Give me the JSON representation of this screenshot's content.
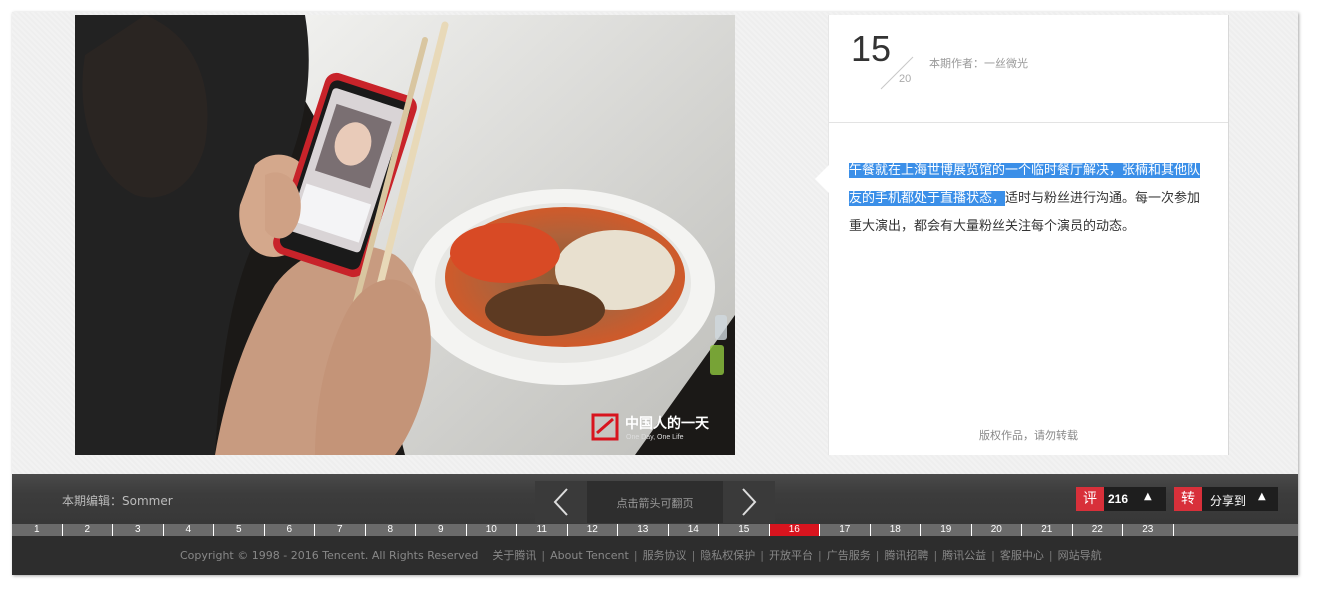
{
  "card": {
    "page_current": "15",
    "page_total": "20",
    "author_label": "本期作者：",
    "author_name": "一丝微光",
    "caption_selected": "午餐就在上海世博展览馆的一个临时餐厅解决，张楠和其他队友的手机都处于直播状态，",
    "caption_rest": "适时与粉丝进行沟通。每一次参加重大演出，都会有大量粉丝关注每个演员的动态。",
    "copyright_note": "版权作品，请勿转载"
  },
  "photo": {
    "watermark_main": "中国人的一天",
    "watermark_sub": "One Day, One Life"
  },
  "nav": {
    "editor_label": "本期编辑：",
    "editor_name": "Sommer",
    "pager_hint": "点击箭头可翻页",
    "comment_tag": "评",
    "comment_count": "216",
    "share_tag": "转",
    "share_label": "分享到"
  },
  "page_numbers": [
    "1",
    "2",
    "3",
    "4",
    "5",
    "6",
    "7",
    "8",
    "9",
    "10",
    "11",
    "12",
    "13",
    "14",
    "15",
    "16",
    "17",
    "18",
    "19",
    "20",
    "21",
    "22",
    "23"
  ],
  "active_page": "16",
  "footer": {
    "copyright": "Copyright © 1998 - 2016 Tencent. All Rights Reserved",
    "links": [
      "关于腾讯",
      "About Tencent",
      "服务协议",
      "隐私权保护",
      "开放平台",
      "广告服务",
      "腾讯招聘",
      "腾讯公益",
      "客服中心",
      "网站导航"
    ]
  },
  "colors": {
    "accent_red": "#d8141e",
    "selection_blue": "#3b8fe8"
  }
}
